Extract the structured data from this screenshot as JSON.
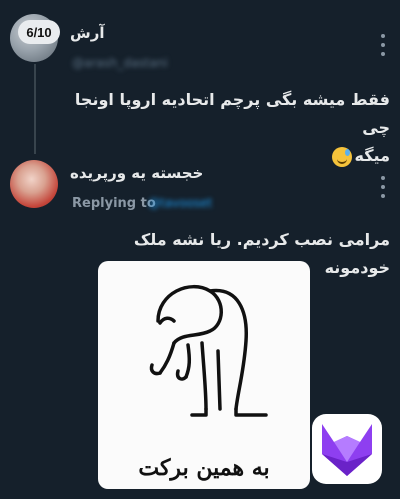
{
  "thread": {
    "counter": "6/10"
  },
  "tweets": [
    {
      "author_name": "آرش",
      "handle": "@arash_dastani",
      "text_line1": "فقط میشه بگی پرچم اتحادیه اروپا اونجا چی",
      "text_line2": "میگه"
    },
    {
      "author_name": "خجسته یه ورپریده",
      "replying_label": "Replying to",
      "replying_handle": "@tavooset",
      "text": "مرامی نصب کردیم. ریا نشه ملک خودمونه",
      "media_caption": "به همین برکت"
    }
  ],
  "icons": {
    "more": "more-vertical-icon",
    "emoji": "grinning-sweat-emoji-icon",
    "brand": "fox-logo-icon"
  },
  "colors": {
    "background": "#15202b",
    "text": "#e7e9ea",
    "muted": "#8b98a5",
    "link": "#1d9bf0",
    "brand_purple": "#8e3ff0"
  }
}
